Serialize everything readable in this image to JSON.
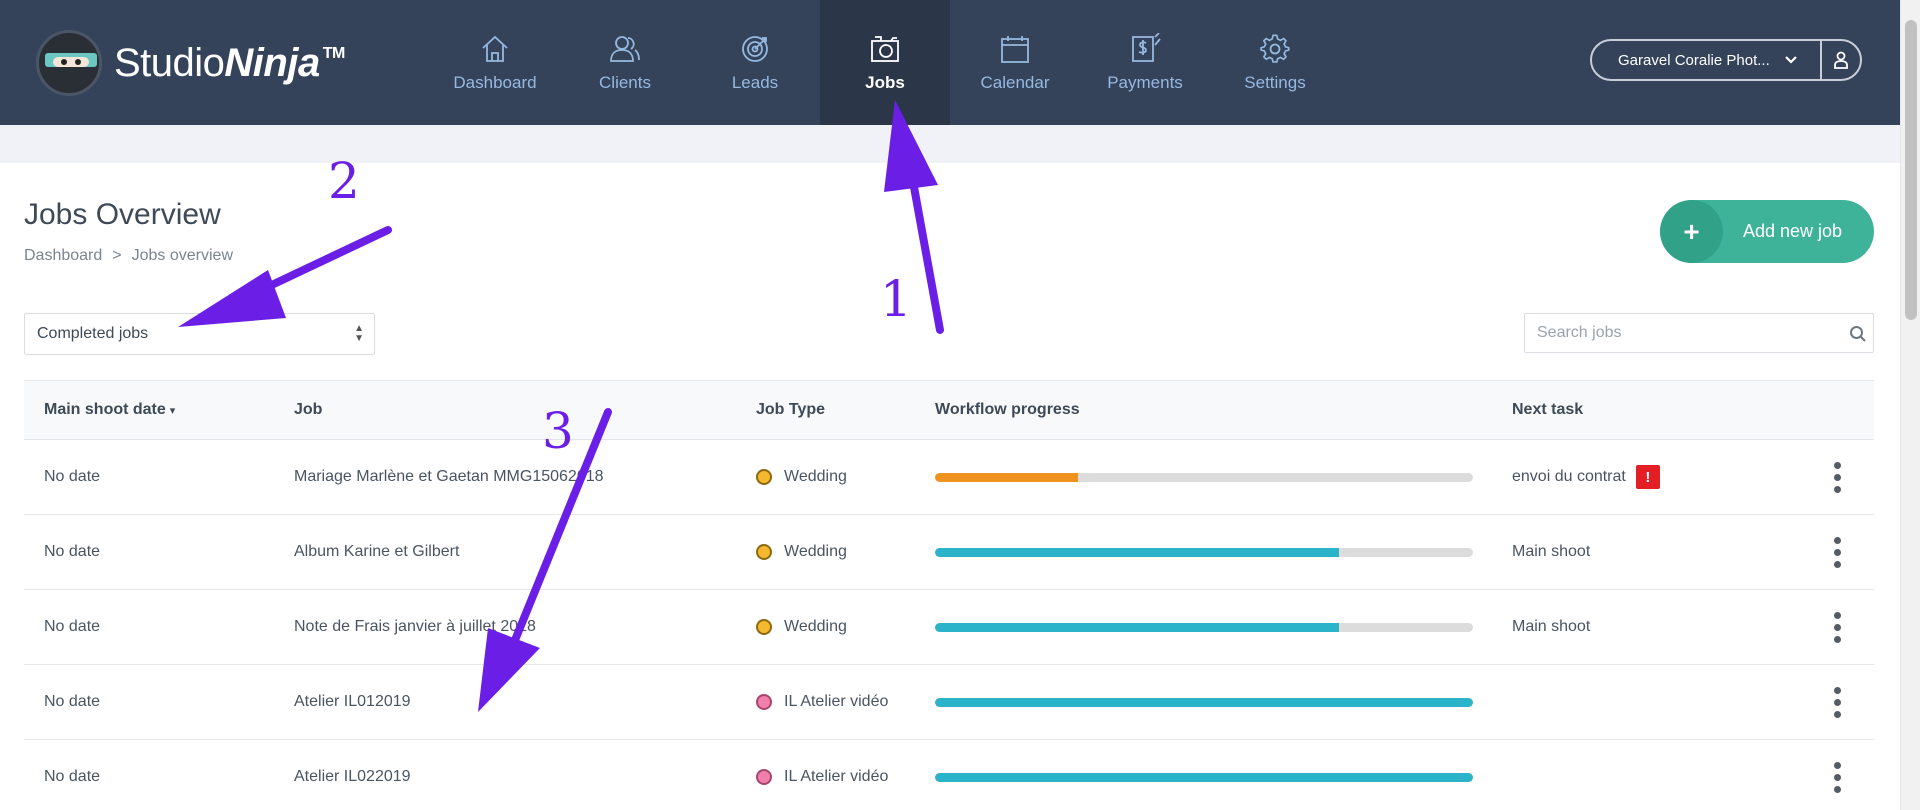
{
  "app": {
    "logo_light": "Studio",
    "logo_bold": "Ninja",
    "logo_tm": "TM"
  },
  "nav": {
    "items": [
      {
        "label": "Dashboard",
        "icon": "home-icon"
      },
      {
        "label": "Clients",
        "icon": "clients-icon"
      },
      {
        "label": "Leads",
        "icon": "target-icon"
      },
      {
        "label": "Jobs",
        "icon": "camera-icon",
        "active": true
      },
      {
        "label": "Calendar",
        "icon": "calendar-icon"
      },
      {
        "label": "Payments",
        "icon": "payments-icon"
      },
      {
        "label": "Settings",
        "icon": "gear-icon"
      }
    ]
  },
  "account": {
    "name": "Garavel Coralie Phot...",
    "chevron": "⌄"
  },
  "page": {
    "title": "Jobs Overview",
    "breadcrumb": [
      "Dashboard",
      ">",
      "Jobs overview"
    ],
    "add_button_plus": "+",
    "add_button_label": "Add new job"
  },
  "filter": {
    "selected": "Completed jobs"
  },
  "search": {
    "placeholder": "Search jobs"
  },
  "table": {
    "headers": {
      "date": "Main shoot date",
      "sort_caret": "▾",
      "job": "Job",
      "type": "Job Type",
      "progress": "Workflow progress",
      "task": "Next task"
    },
    "rows": [
      {
        "date": "No date",
        "job": "Mariage Marlène et Gaetan MMG15062018",
        "type": "Wedding",
        "type_color": "#f5b82e",
        "progress": 0.265,
        "progress_color": "#f0931e",
        "task": "envoi du contrat",
        "alert": "!"
      },
      {
        "date": "No date",
        "job": "Album Karine et Gilbert",
        "type": "Wedding",
        "type_color": "#f5b82e",
        "progress": 0.75,
        "progress_color": "#2ab3c9",
        "task": "Main shoot",
        "alert": ""
      },
      {
        "date": "No date",
        "job": "Note de Frais janvier à juillet 2018",
        "type": "Wedding",
        "type_color": "#f5b82e",
        "progress": 0.75,
        "progress_color": "#2ab3c9",
        "task": "Main shoot",
        "alert": ""
      },
      {
        "date": "No date",
        "job": "Atelier IL012019",
        "type": "IL Atelier vidéo",
        "type_color": "#f07fab",
        "progress": 1.0,
        "progress_color": "#2ab3c9",
        "task": "",
        "alert": ""
      },
      {
        "date": "No date",
        "job": "Atelier IL022019",
        "type": "IL Atelier vidéo",
        "type_color": "#f07fab",
        "progress": 1.0,
        "progress_color": "#2ab3c9",
        "task": "",
        "alert": ""
      }
    ]
  },
  "annotations": {
    "labels": [
      "1",
      "2",
      "3"
    ],
    "color": "#6b1fe6"
  }
}
